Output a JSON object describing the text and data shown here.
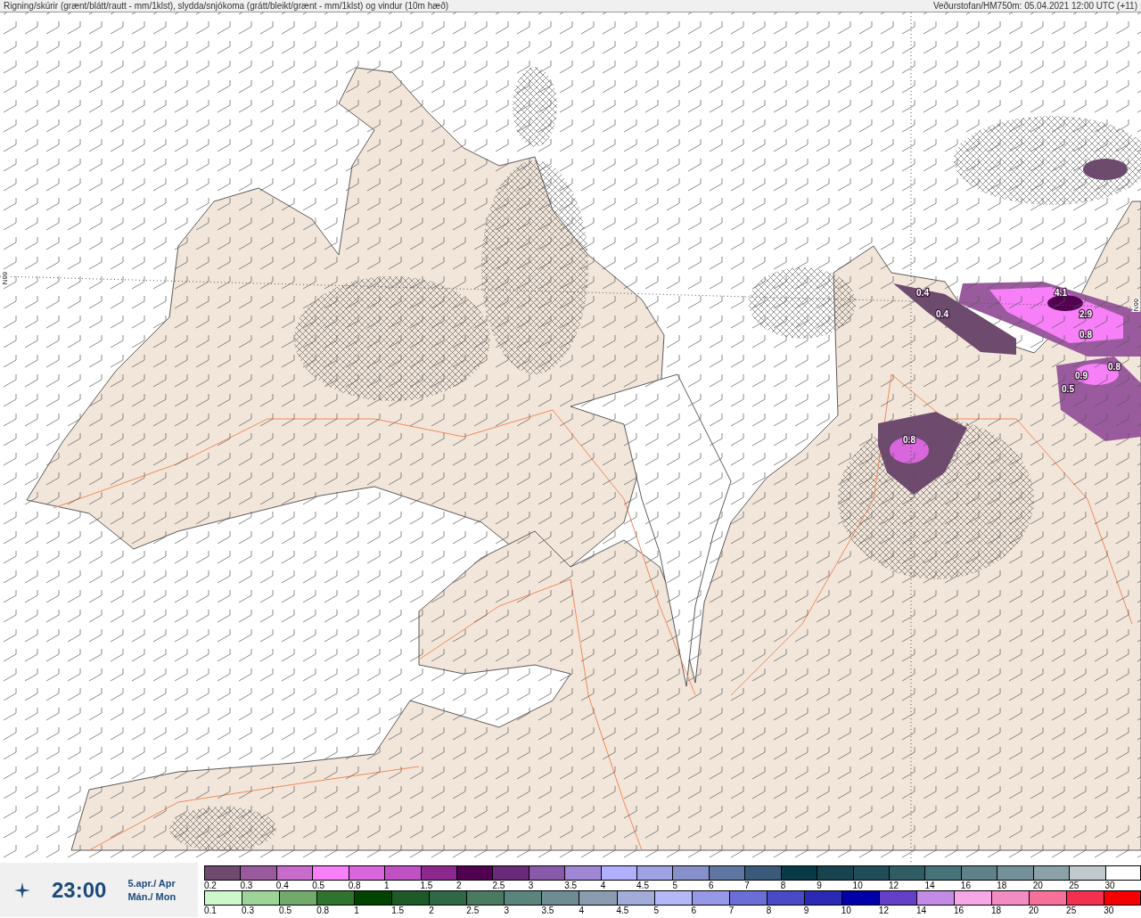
{
  "header": {
    "title": "Rigning/skúrir (grænt/blátt/rautt - mm/1klst), slydda/snjókoma (grátt/bleikt/grænt - mm/1klst) og vindur (10m hæð)",
    "source": "Veðurstofan/HM750m: 05.04.2021 12:00 UTC (+11)"
  },
  "map": {
    "grid_labels": [
      "66N",
      "66N"
    ],
    "value_labels": [
      "0.4",
      "0.4",
      "4.1",
      "2.9",
      "0.8",
      "0.8",
      "0.9",
      "0.5",
      "0.8"
    ]
  },
  "time_panel": {
    "time": "23:00",
    "date": "5.apr./ Apr",
    "day": "Mán./ Mon"
  },
  "legends": [
    {
      "cells": [
        {
          "label": "0.2",
          "color": "#6e4a6e"
        },
        {
          "label": "0.3",
          "color": "#9a5a9e"
        },
        {
          "label": "0.4",
          "color": "#c86ccc"
        },
        {
          "label": "0.5",
          "color": "#f77ff7"
        },
        {
          "label": "0.8",
          "color": "#d966dd"
        },
        {
          "label": "1",
          "color": "#c052c4"
        },
        {
          "label": "1.5",
          "color": "#8c288e"
        },
        {
          "label": "2",
          "color": "#520050"
        },
        {
          "label": "2.5",
          "color": "#6a2a7a"
        },
        {
          "label": "3",
          "color": "#8a5aaa"
        },
        {
          "label": "3.5",
          "color": "#9f87d6"
        },
        {
          "label": "4",
          "color": "#b0b0ff"
        },
        {
          "label": "4.5",
          "color": "#9ea2e2"
        },
        {
          "label": "5",
          "color": "#8890cc"
        },
        {
          "label": "6",
          "color": "#5f75a2"
        },
        {
          "label": "7",
          "color": "#3a5a7a"
        },
        {
          "label": "8",
          "color": "#083a46"
        },
        {
          "label": "9",
          "color": "#16434e"
        },
        {
          "label": "10",
          "color": "#1f4e58"
        },
        {
          "label": "12",
          "color": "#305d64"
        },
        {
          "label": "14",
          "color": "#46727a"
        },
        {
          "label": "16",
          "color": "#5e8288"
        },
        {
          "label": "18",
          "color": "#74919a"
        },
        {
          "label": "20",
          "color": "#8aa2a8"
        },
        {
          "label": "25",
          "color": "#c0cacc"
        },
        {
          "label": "30",
          "color": "#ffffff"
        }
      ]
    },
    {
      "cells": [
        {
          "label": "0.1",
          "color": "#ccf8cc"
        },
        {
          "label": "0.3",
          "color": "#9ed49a"
        },
        {
          "label": "0.5",
          "color": "#72aa6c"
        },
        {
          "label": "0.8",
          "color": "#2e742e"
        },
        {
          "label": "1",
          "color": "#004400"
        },
        {
          "label": "1.5",
          "color": "#1e5a28"
        },
        {
          "label": "2",
          "color": "#2e6844"
        },
        {
          "label": "2.5",
          "color": "#4a7a60"
        },
        {
          "label": "3",
          "color": "#5a847c"
        },
        {
          "label": "3.5",
          "color": "#6e8c94"
        },
        {
          "label": "4",
          "color": "#8c9cb0"
        },
        {
          "label": "4.5",
          "color": "#a2acd8"
        },
        {
          "label": "5",
          "color": "#b4b8f8"
        },
        {
          "label": "6",
          "color": "#9698e8"
        },
        {
          "label": "7",
          "color": "#6a6ed6"
        },
        {
          "label": "8",
          "color": "#4a4ac8"
        },
        {
          "label": "9",
          "color": "#2a2ab4"
        },
        {
          "label": "10",
          "color": "#0000a8"
        },
        {
          "label": "12",
          "color": "#6440c8"
        },
        {
          "label": "14",
          "color": "#c28ce6"
        },
        {
          "label": "16",
          "color": "#f6a8e6"
        },
        {
          "label": "18",
          "color": "#f48cc4"
        },
        {
          "label": "20",
          "color": "#f6709a"
        },
        {
          "label": "25",
          "color": "#f43050"
        },
        {
          "label": "30",
          "color": "#f40000"
        }
      ]
    }
  ]
}
